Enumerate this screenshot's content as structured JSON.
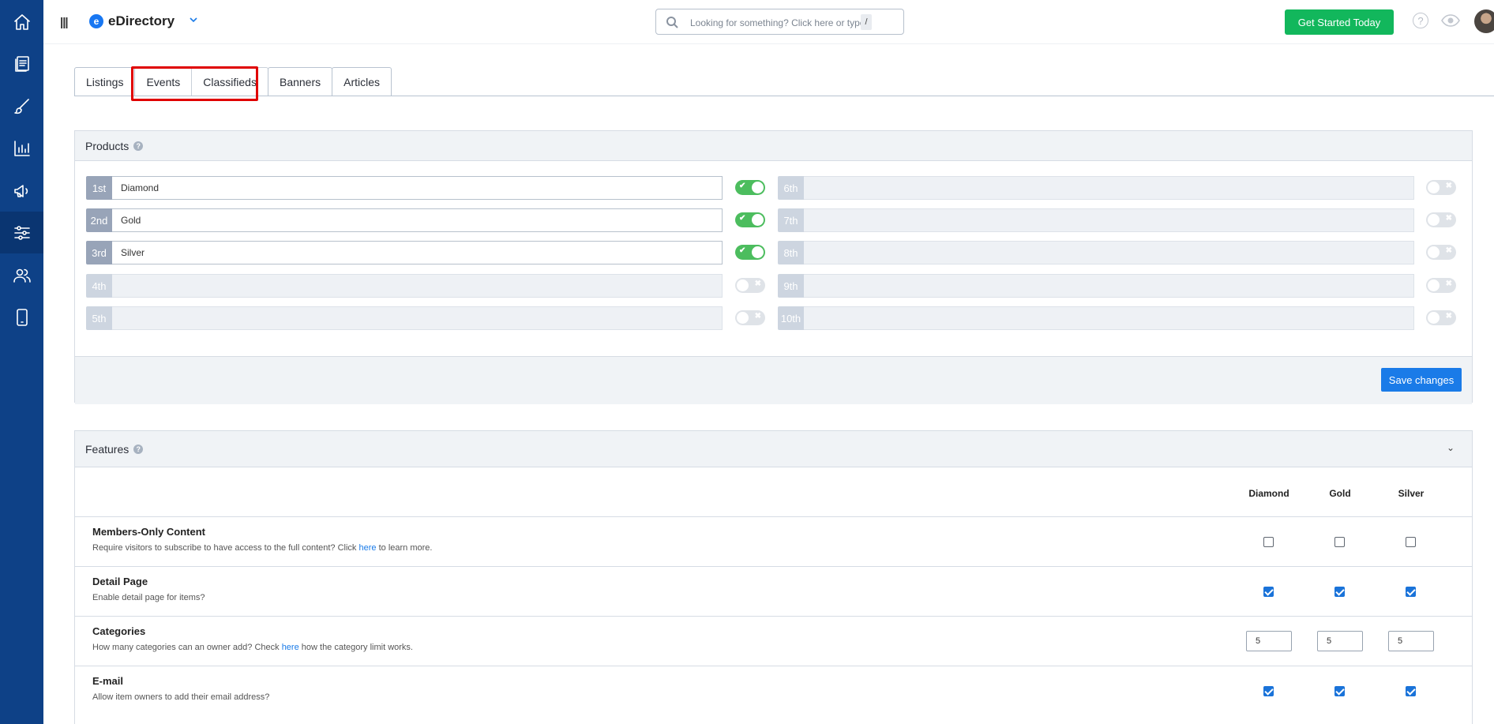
{
  "sidebar": {
    "items": [
      {
        "icon": "home-icon"
      },
      {
        "icon": "content-icon"
      },
      {
        "icon": "design-icon"
      },
      {
        "icon": "reports-icon"
      },
      {
        "icon": "promote-icon"
      },
      {
        "icon": "settings-sliders-icon",
        "active": true
      },
      {
        "icon": "users-icon"
      },
      {
        "icon": "mobile-icon"
      }
    ]
  },
  "header": {
    "brand": "eDirectory",
    "search_placeholder": "Looking for something? Click here or type",
    "search_shortcut": "/",
    "cta": "Get Started Today"
  },
  "tabs": [
    "Listings",
    "Events",
    "Classifieds",
    "Banners",
    "Articles"
  ],
  "products": {
    "title": "Products",
    "left": [
      {
        "idx": "1st",
        "name": "Diamond",
        "enabled": true
      },
      {
        "idx": "2nd",
        "name": "Gold",
        "enabled": true
      },
      {
        "idx": "3rd",
        "name": "Silver",
        "enabled": true
      },
      {
        "idx": "4th",
        "name": "",
        "enabled": false
      },
      {
        "idx": "5th",
        "name": "",
        "enabled": false
      }
    ],
    "right": [
      {
        "idx": "6th",
        "name": "",
        "enabled": false
      },
      {
        "idx": "7th",
        "name": "",
        "enabled": false
      },
      {
        "idx": "8th",
        "name": "",
        "enabled": false
      },
      {
        "idx": "9th",
        "name": "",
        "enabled": false
      },
      {
        "idx": "10th",
        "name": "",
        "enabled": false
      }
    ],
    "save_label": "Save changes"
  },
  "features": {
    "title": "Features",
    "columns": [
      "Diamond",
      "Gold",
      "Silver"
    ],
    "rows": [
      {
        "title": "Members-Only Content",
        "desc_before": "Require visitors to subscribe to have access to the full content? Click ",
        "link": "here",
        "desc_after": " to learn more.",
        "type": "checkbox",
        "values": [
          false,
          false,
          false
        ]
      },
      {
        "title": "Detail Page",
        "desc_before": "Enable detail page for items?",
        "link": "",
        "desc_after": "",
        "type": "checkbox",
        "values": [
          true,
          true,
          true
        ]
      },
      {
        "title": "Categories",
        "desc_before": "How many categories can an owner add? Check ",
        "link": "here",
        "desc_after": " how the category limit works.",
        "type": "number",
        "values": [
          "5",
          "5",
          "5"
        ]
      },
      {
        "title": "E-mail",
        "desc_before": "Allow item owners to add their email address?",
        "link": "",
        "desc_after": "",
        "type": "checkbox",
        "values": [
          true,
          true,
          true
        ]
      }
    ]
  }
}
